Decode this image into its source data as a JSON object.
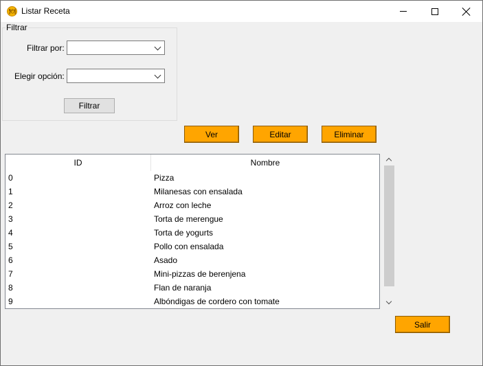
{
  "window": {
    "title": "Listar Receta",
    "icon": "recipe-app-icon"
  },
  "filter": {
    "group_title": "Filtrar",
    "filter_by_label": "Filtrar por:",
    "filter_by_value": "",
    "choose_option_label": "Elegir opción:",
    "choose_option_value": "",
    "filter_button": "Filtrar"
  },
  "actions": {
    "view": "Ver",
    "edit": "Editar",
    "delete": "Eliminar",
    "exit": "Salir"
  },
  "table": {
    "columns": [
      "ID",
      "Nombre"
    ],
    "rows": [
      {
        "id": "0",
        "nombre": "Pizza"
      },
      {
        "id": "1",
        "nombre": "Milanesas con ensalada"
      },
      {
        "id": "2",
        "nombre": "Arroz con leche"
      },
      {
        "id": "3",
        "nombre": "Torta de merengue"
      },
      {
        "id": "4",
        "nombre": "Torta de yogurts"
      },
      {
        "id": "5",
        "nombre": "Pollo con ensalada"
      },
      {
        "id": "6",
        "nombre": "Asado"
      },
      {
        "id": "7",
        "nombre": "Mini-pizzas de berenjena"
      },
      {
        "id": "8",
        "nombre": "Flan de naranja"
      },
      {
        "id": "9",
        "nombre": "Albóndigas de cordero con tomate"
      }
    ]
  },
  "colors": {
    "accent_button": "#ffa500",
    "window_bg": "#f0f0f0"
  }
}
